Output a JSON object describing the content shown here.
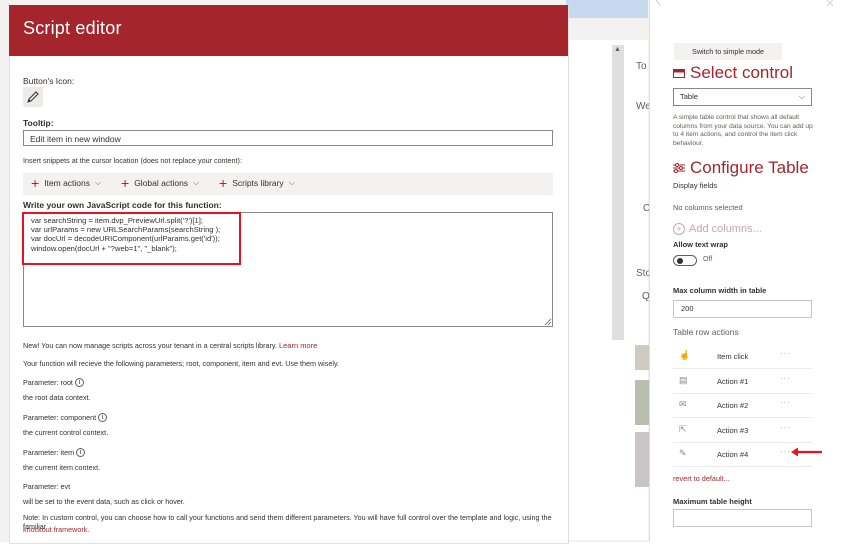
{
  "background": {
    "text_top": "To",
    "text_we": "We",
    "text_c": "C",
    "text_sto": "Sto",
    "text_q": "Q"
  },
  "editor": {
    "title": "Script editor",
    "icon_label": "Button's Icon:",
    "tooltip_label": "Tooltip:",
    "tooltip_value": "Edit item in new window",
    "snippet_hint": "Insert snippets at the cursor location (does not replace your content):",
    "snippets": [
      "Item actions",
      "Global actions",
      "Scripts library"
    ],
    "code_label": "Write your own JavaScript code for this function:",
    "code_lines": [
      "var searchString = item.dvp_PreviewUrl.split('?')[1];",
      "var urlParams = new URLSearchParams(searchString );",
      "var docUrl = decodeURIComponent(urlParams.get('id'));",
      "window.open(docUrl + \"?web=1\", \"_blank\");"
    ],
    "new_notice": "New! You can now manage scripts across your tenant in a central scripts library.",
    "learn_more": "Learn more",
    "params_intro": "Your function will recieve the following parameters; root, component, item and evt. Use them wisely.",
    "params": [
      {
        "name": "Parameter: root",
        "desc": "the root data context."
      },
      {
        "name": "Parameter: component",
        "desc": "the current control context."
      },
      {
        "name": "Parameter: item",
        "desc": "the current item context."
      },
      {
        "name": "Parameter: evt",
        "desc": "will be set to the event data, such as click or hover."
      }
    ],
    "note": "Note: In custom control, you can choose how to call your functions and send them different parameters. You will have full control over the template and logic, using the familiar",
    "knockout_link": "knockout framework."
  },
  "panel": {
    "switch_button": "Switch to simple mode",
    "select_control_title": "Select control",
    "select_value": "Table",
    "select_desc": "A simple table control that shows all default columns from your data source. You can add up to 4 item actions, and control the item click behaviour.",
    "configure_title": "Configure Table",
    "display_fields_label": "Display fields",
    "no_columns": "No columns selected",
    "add_columns": "Add columns...",
    "allow_wrap_label": "Allow text wrap",
    "toggle_state": "Off",
    "max_width_label": "Max column width in table",
    "max_width_value": "200",
    "row_actions_label": "Table row actions",
    "row_actions": [
      {
        "label": "Item click",
        "icon": "pointer-icon"
      },
      {
        "label": "Action #1",
        "icon": "document-icon"
      },
      {
        "label": "Action #2",
        "icon": "mail-icon"
      },
      {
        "label": "Action #3",
        "icon": "share-icon"
      },
      {
        "label": "Action #4",
        "icon": "pencil-icon"
      }
    ],
    "revert_link": "revert to default...",
    "max_height_label": "Maximum table height",
    "max_height_value": ""
  },
  "colors": {
    "accent": "#a4262c",
    "highlight_box": "#e81123"
  }
}
